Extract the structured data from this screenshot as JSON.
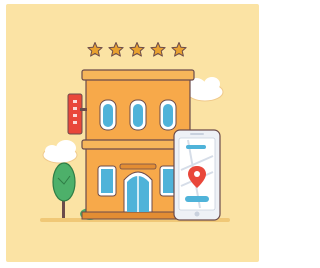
{
  "illustration": {
    "rating": {
      "stars": 5,
      "filled": 5
    },
    "colors": {
      "background": "#fbe3a4",
      "building": "#f7a94a",
      "building_dark": "#e38d33",
      "roof": "#f6b65a",
      "window": "#4fb3d9",
      "window_frame": "#ffffff",
      "outline": "#6b4b4b",
      "star": "#e9a230",
      "sign": "#e9473a",
      "tree": "#4db06a",
      "phone": "#eef1f6",
      "pin": "#e9473a",
      "cloud": "#ffffff",
      "ground": "#f3c77c"
    },
    "icons": [
      "star-icon",
      "hotel-building-icon",
      "smartphone-icon",
      "map-pin-icon",
      "tree-icon",
      "cloud-icon",
      "hotel-sign-icon"
    ]
  }
}
